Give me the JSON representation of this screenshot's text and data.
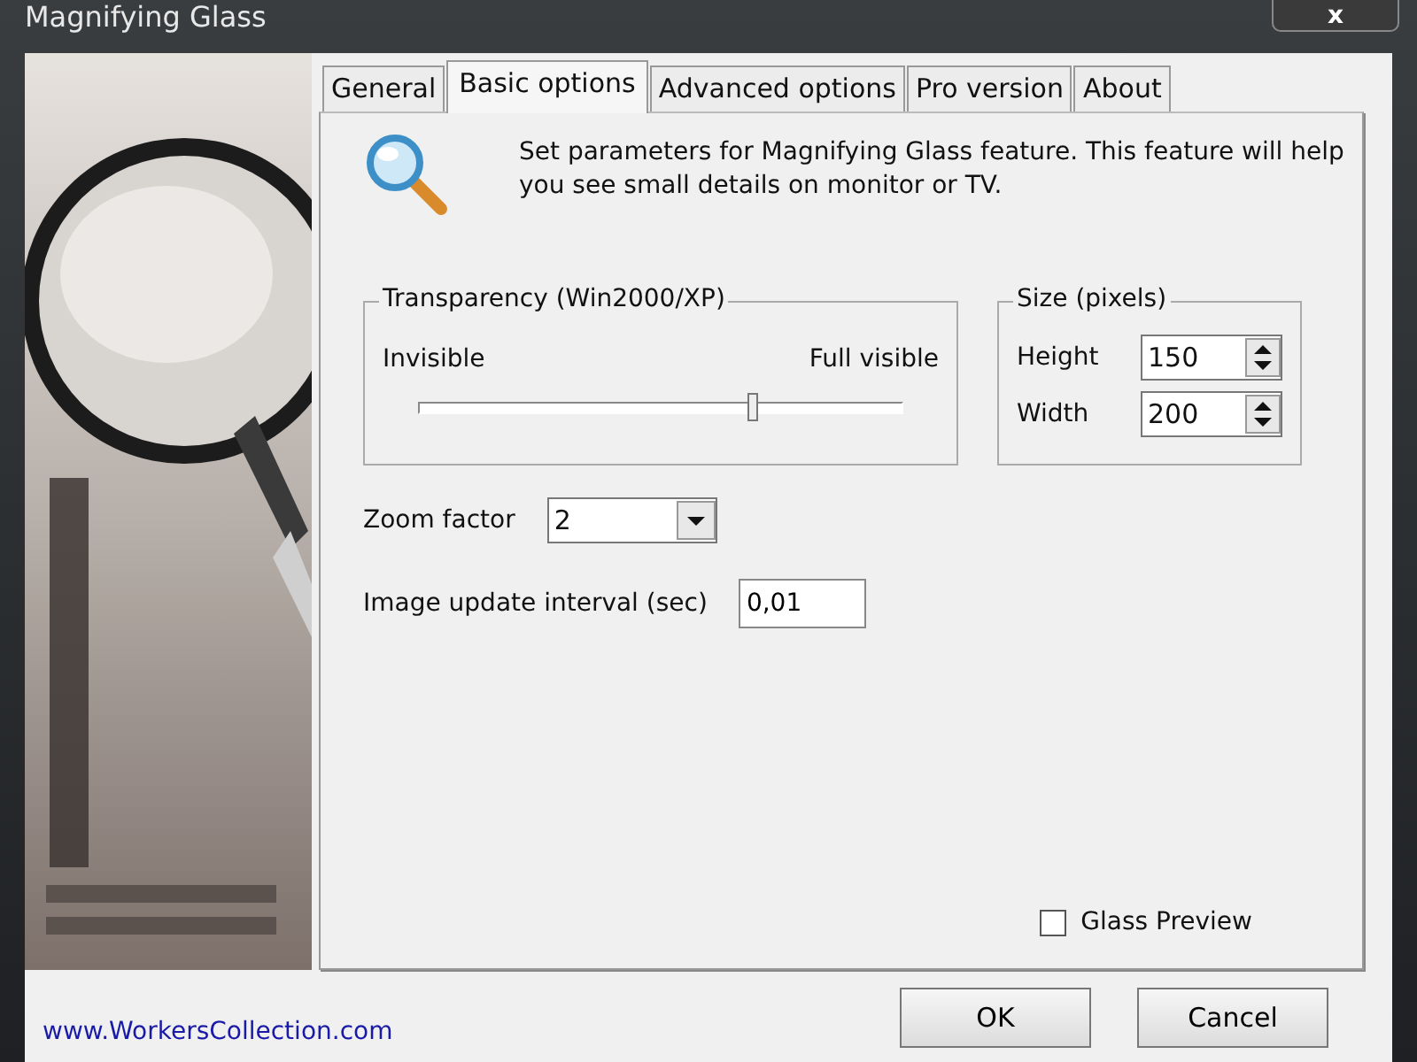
{
  "window": {
    "title": "Magnifying Glass",
    "close": "x"
  },
  "tabs": [
    {
      "label": "General",
      "selected": false
    },
    {
      "label": "Basic options",
      "selected": true
    },
    {
      "label": "Advanced options",
      "selected": false
    },
    {
      "label": "Pro version",
      "selected": false
    },
    {
      "label": "About",
      "selected": false
    }
  ],
  "description": "Set parameters for Magnifying Glass feature. This feature will help you see small details on monitor or TV.",
  "transparency": {
    "title": "Transparency (Win2000/XP)",
    "min_label": "Invisible",
    "max_label": "Full visible",
    "level": 0.69
  },
  "size": {
    "title": "Size (pixels)",
    "fields": [
      {
        "label": "Height",
        "value": "150"
      },
      {
        "label": "Width",
        "value": "200"
      }
    ]
  },
  "zoom_factor": {
    "label": "Zoom factor",
    "value": "2"
  },
  "update_interval": {
    "label": "Image update interval (sec)",
    "value": "0,01"
  },
  "glass_preview": {
    "label": "Glass Preview",
    "checked": false
  },
  "link": "www.WorkersCollection.com",
  "buttons": [
    "OK",
    "Cancel"
  ]
}
